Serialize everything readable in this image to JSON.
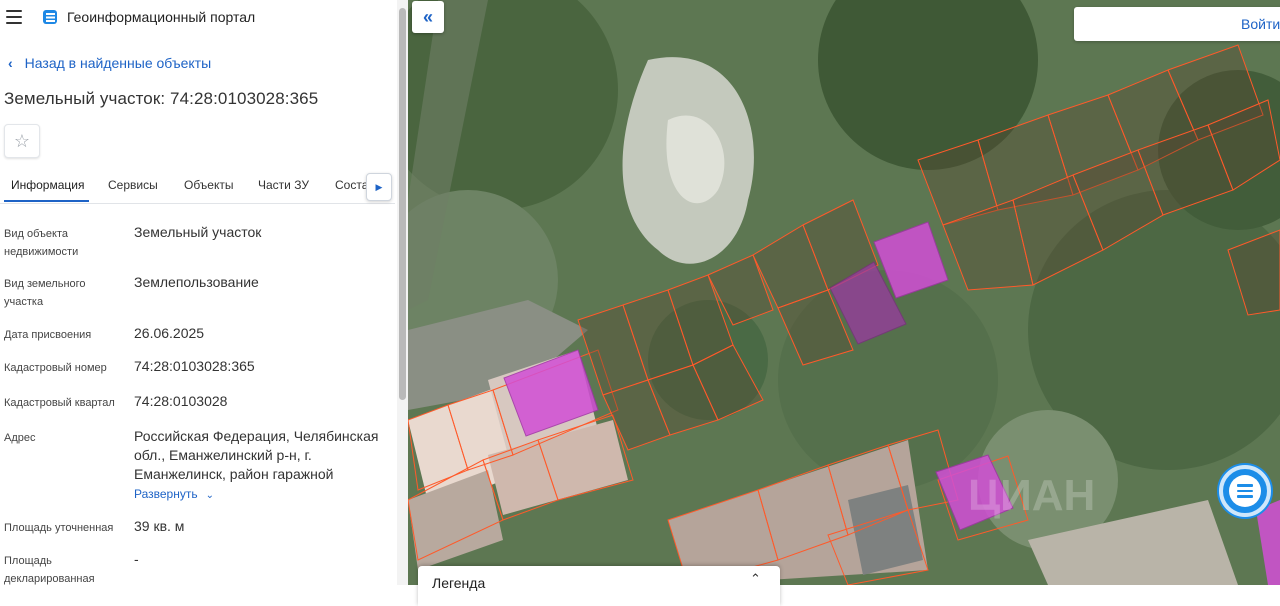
{
  "header": {
    "app_title": "Геоинформационный портал",
    "menu_icon": "hamburger-icon",
    "logo_icon": "portal-logo-icon"
  },
  "nav": {
    "back_label": "Назад в найденные объекты"
  },
  "object": {
    "title": "Земельный участок: 74:28:0103028:365"
  },
  "tabs": [
    {
      "label": "Информация"
    },
    {
      "label": "Сервисы"
    },
    {
      "label": "Объекты"
    },
    {
      "label": "Части ЗУ"
    },
    {
      "label": "Соста"
    }
  ],
  "properties": [
    {
      "label": "Вид объекта недвижимости",
      "value": "Земельный участок"
    },
    {
      "label": "Вид земельного участка",
      "value": "Землепользование"
    },
    {
      "label": "Дата присвоения",
      "value": "26.06.2025"
    },
    {
      "label": "Кадастровый номер",
      "value": "74:28:0103028:365"
    },
    {
      "label": "Кадастровый квартал",
      "value": "74:28:0103028"
    },
    {
      "label": "Адрес",
      "value": "Российская Федерация, Челябинская обл., Еманжелинский р-н, г. Еманжелинск, район гаражной"
    },
    {
      "label": "Площадь уточненная",
      "value": "39 кв. м"
    },
    {
      "label": "Площадь декларированная",
      "value": "-"
    }
  ],
  "expand_label": "Развернуть",
  "map": {
    "login_label": "Войти",
    "legend_label": "Легенда",
    "collapse_icon": "double-chevron-left-icon",
    "chat_icon": "chat-icon",
    "watermark": "ЦИАН"
  },
  "colors": {
    "accent": "#1e63c6",
    "parcel_outline": "#ff5a2a",
    "selected_parcel": "#d24fd6",
    "chat": "#1c8de8"
  }
}
